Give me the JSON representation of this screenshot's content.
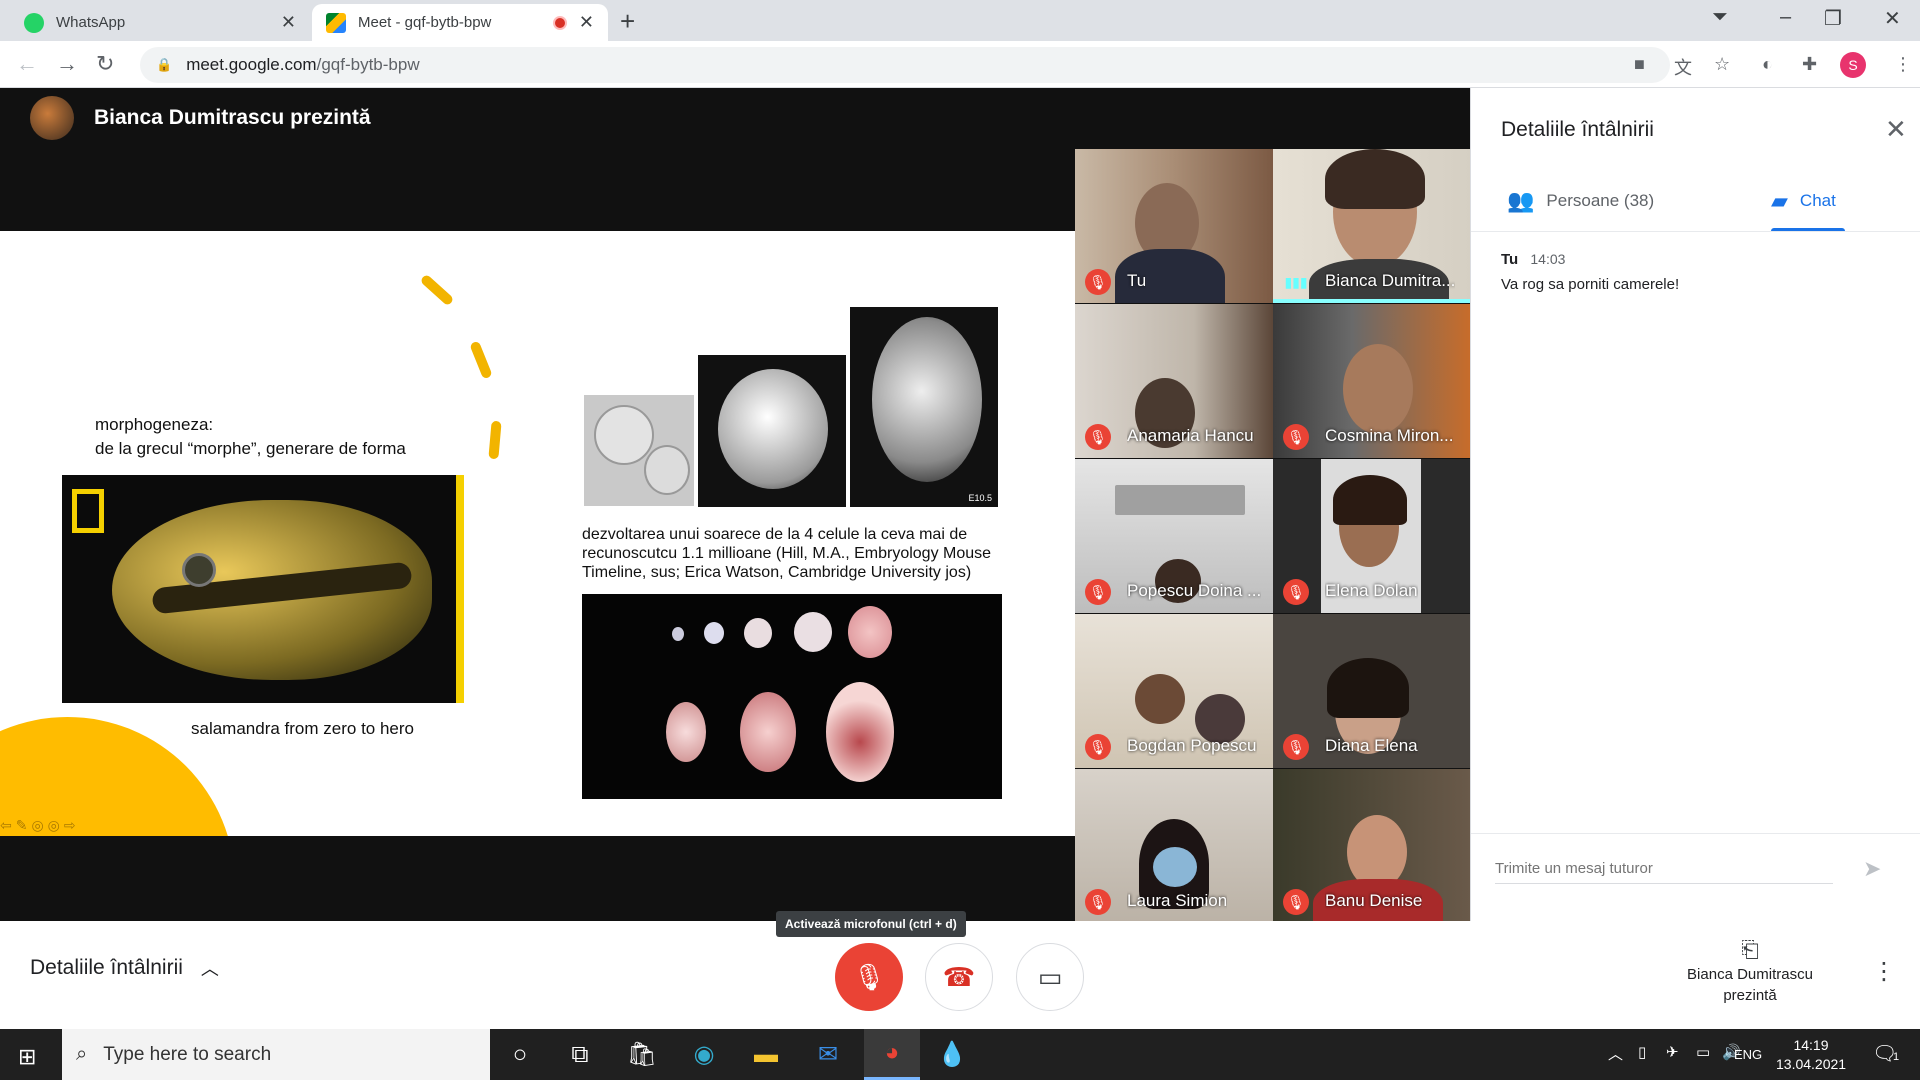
{
  "browser": {
    "tabs": [
      {
        "title": "WhatsApp",
        "icon": "whatsapp-icon",
        "active": false
      },
      {
        "title": "Meet - gqf-bytb-bpw",
        "icon": "meet-icon",
        "active": true
      }
    ],
    "url_host": "meet.google.com",
    "url_path": "/gqf-bytb-bpw",
    "profile_initial": "S"
  },
  "meet": {
    "presenter_text": "Bianca Dumitrascu prezintă",
    "slide": {
      "title_line1": "morphogeneza:",
      "title_line2": "de la grecul “morphe”, generare de forma",
      "salamander_caption": "salamandra from zero to hero",
      "embryo_caption_line1": "dezvoltarea unui soarece de la 4 celule la ceva mai de",
      "embryo_caption_line2": "recunoscutcu 1.1 millioane  (Hill, M.A., Embryology Mouse",
      "embryo_caption_line3": "Timeline, sus; Erica Watson, Cambridge University jos)",
      "label_e105": "E10.5"
    },
    "participants": [
      {
        "name": "Tu",
        "muted": true
      },
      {
        "name": "Bianca Dumitra...",
        "muted": false,
        "speaking": true
      },
      {
        "name": "Anamaria Hancu",
        "muted": true
      },
      {
        "name": "Cosmina Miron...",
        "muted": true
      },
      {
        "name": "Popescu Doina ...",
        "muted": true
      },
      {
        "name": "Elena Dolan",
        "muted": true
      },
      {
        "name": "Bogdan Popescu",
        "muted": true
      },
      {
        "name": "Diana Elena",
        "muted": true
      },
      {
        "name": "Laura Simion",
        "muted": true
      },
      {
        "name": "Banu Denise",
        "muted": true
      }
    ],
    "bottom": {
      "details_label": "Detaliile întâlnirii",
      "mic_tooltip": "Activează microfonul (ctrl + d)",
      "present_line1": "Bianca Dumitrascu",
      "present_line2": "prezintă"
    }
  },
  "panel": {
    "title": "Detaliile întâlnirii",
    "people_tab": "Persoane (38)",
    "chat_tab": "Chat",
    "messages": [
      {
        "sender": "Tu",
        "time": "14:03",
        "text": "Va rog sa porniti camerele!"
      }
    ],
    "input_placeholder": "Trimite un mesaj tuturor"
  },
  "taskbar": {
    "search_placeholder": "Type here to search",
    "language": "ENG",
    "time": "14:19",
    "date": "13.04.2021",
    "notification_count": "1"
  },
  "colors": {
    "accent_blue": "#1a73e8",
    "mute_red": "#ea4335",
    "slide_yellow": "#ffbc00"
  }
}
